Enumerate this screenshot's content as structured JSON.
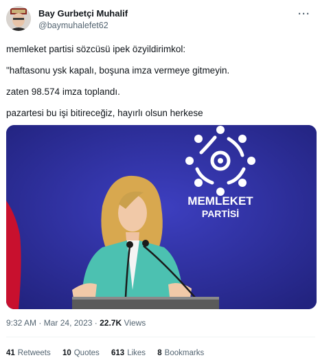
{
  "author": {
    "display_name": "Bay Gurbetçi Muhalif",
    "handle": "@baymuhalefet62"
  },
  "more_icon": "ellipsis-icon",
  "tweet": {
    "paragraphs": [
      "memleket partisi sözcüsü ipek özyildirimkol:",
      "\"haftasonu ysk kapalı, boşuna imza vermeye gitmeyin.",
      "zaten 98.574 imza toplandı.",
      "pazartesi bu işi bitireceğiz, hayırlı olsun herkese"
    ]
  },
  "media": {
    "logo_line1": "MEMLEKET",
    "logo_line2": "PARTİSİ"
  },
  "meta": {
    "time": "9:32 AM",
    "date": "Mar 24, 2023",
    "views_count": "22.7K",
    "views_label": "Views"
  },
  "stats": {
    "retweets_count": "41",
    "retweets_label": "Retweets",
    "quotes_count": "10",
    "quotes_label": "Quotes",
    "likes_count": "613",
    "likes_label": "Likes",
    "bookmarks_count": "8",
    "bookmarks_label": "Bookmarks"
  },
  "colors": {
    "media_background": "#2b2c9c",
    "blazer": "#4cc1b1",
    "secondary_text": "#536471"
  }
}
